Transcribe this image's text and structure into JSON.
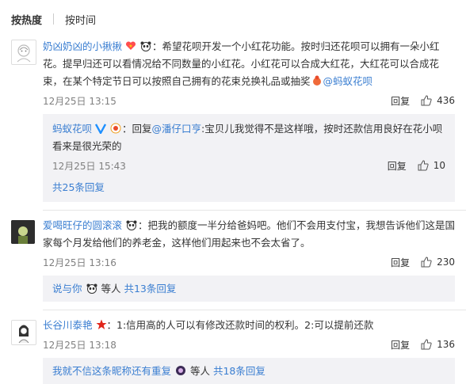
{
  "sort": {
    "hot": "按热度",
    "time": "按时间"
  },
  "comments": [
    {
      "user": "奶凶奶凶的小揪揪",
      "text": "：希望花呗开发一个小红花功能。按时归还花呗可以拥有一朵小红花。提早归还可以看情况给不同数量的小红花。小红花可以合成大红花，大红花可以合成花束，在某个特定节日可以按照自己拥有的花束兑换礼品或抽奖",
      "mention": "@蚂蚁花呗",
      "time": "12月25日 13:15",
      "reply": "回复",
      "likes": "436",
      "sub": {
        "user": "蚂蚁花呗",
        "reply_prefix": "：回复",
        "mention": "@潘仔口亨",
        "text": ":宝贝儿我觉得不是这样哦，按时还款信用良好在花小呗看来是很光荣的",
        "time": "12月25日 15:43",
        "reply": "回复",
        "likes": "10",
        "more": "共25条回复"
      }
    },
    {
      "user": "爱喝旺仔的圆滚滚",
      "text": "：把我的额度一半分给爸妈吧。他们不会用支付宝，我想告诉他们这是国家每个月发给他们的养老金，这样他们用起来也不会太省了。",
      "time": "12月25日 13:16",
      "reply": "回复",
      "likes": "230",
      "more_prefix": "说与你",
      "more_mid": "等人",
      "more_count": "共13条回复"
    },
    {
      "user": "长谷川泰艳",
      "text": "：1:信用高的人可以有修改还款时间的权利。2:可以提前还款",
      "time": "12月25日 13:18",
      "reply": "回复",
      "likes": "136",
      "more_prefix": "我就不信这条昵称还有重复",
      "more_mid": "等人",
      "more_count": "共18条回复"
    }
  ]
}
